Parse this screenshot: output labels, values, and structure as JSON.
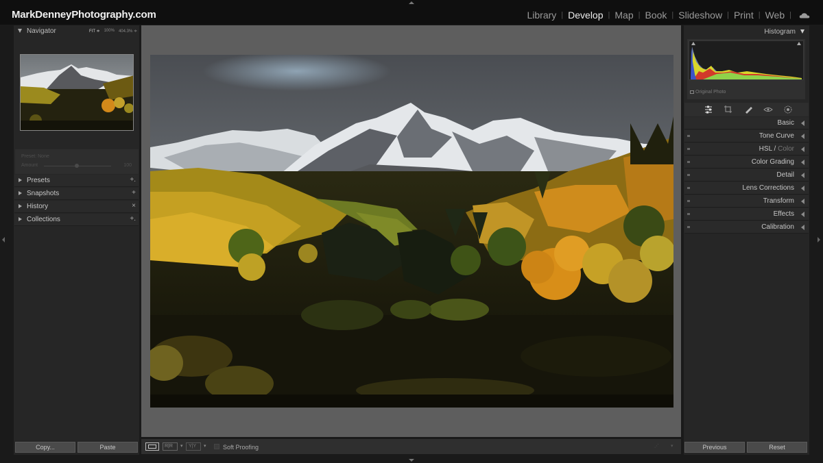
{
  "brand": "MarkDenneyPhotography.com",
  "modules": [
    {
      "label": "Library",
      "active": false
    },
    {
      "label": "Develop",
      "active": true
    },
    {
      "label": "Map",
      "active": false
    },
    {
      "label": "Book",
      "active": false
    },
    {
      "label": "Slideshow",
      "active": false
    },
    {
      "label": "Print",
      "active": false
    },
    {
      "label": "Web",
      "active": false
    }
  ],
  "left": {
    "navigator": {
      "title": "Navigator",
      "zoom_options": [
        "FIT ≑",
        "100%",
        "404.3% ≑"
      ]
    },
    "navigator_box": {
      "line1": "Preset: None",
      "line2": "Amount",
      "line3": "100"
    },
    "sections": [
      {
        "label": "Presets",
        "action": "+."
      },
      {
        "label": "Snapshots",
        "action": "+"
      },
      {
        "label": "History",
        "action": "×"
      },
      {
        "label": "Collections",
        "action": "+."
      }
    ],
    "copy_label": "Copy...",
    "paste_label": "Paste"
  },
  "toolbar": {
    "soft_proofing_label": "Soft Proofing"
  },
  "right": {
    "histogram": {
      "title": "Histogram",
      "caption": "Original Photo"
    },
    "panels": [
      {
        "label": "Basic",
        "dim_suffix": ""
      },
      {
        "label": "Tone Curve",
        "dim_suffix": ""
      },
      {
        "label": "HSL / ",
        "dim_suffix": "Color"
      },
      {
        "label": "Color Grading",
        "dim_suffix": ""
      },
      {
        "label": "Detail",
        "dim_suffix": ""
      },
      {
        "label": "Lens Corrections",
        "dim_suffix": ""
      },
      {
        "label": "Transform",
        "dim_suffix": ""
      },
      {
        "label": "Effects",
        "dim_suffix": ""
      },
      {
        "label": "Calibration",
        "dim_suffix": ""
      }
    ],
    "previous_label": "Previous",
    "reset_label": "Reset"
  },
  "icons": {
    "cloud": "cloud-icon",
    "sliders": "sliders-icon",
    "crop": "crop-icon",
    "heal": "healing-icon",
    "redeye": "red-eye-icon",
    "mask": "masking-icon"
  },
  "colors": {
    "accent_active": "#eeeeee",
    "panel": "#262626",
    "center_bg": "#5e5e5e"
  }
}
